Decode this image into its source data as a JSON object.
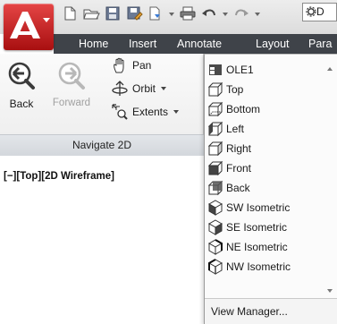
{
  "quick_access": {
    "icons": [
      "new-icon",
      "open-icon",
      "save-icon",
      "save-as-icon",
      "publish-icon",
      "plot-icon",
      "undo-icon",
      "redo-icon",
      "workspace-gear-icon"
    ],
    "workspace_text": "D"
  },
  "tabs": [
    {
      "label": "Home"
    },
    {
      "label": "Insert"
    },
    {
      "label": "Annotate"
    },
    {
      "label": "Layout"
    },
    {
      "label": "Para"
    }
  ],
  "navigate_panel": {
    "title": "Navigate 2D",
    "back_label": "Back",
    "forward_label": "Forward",
    "pan_label": "Pan",
    "orbit_label": "Orbit",
    "extents_label": "Extents"
  },
  "viewport": {
    "label": "[−][Top][2D Wireframe]"
  },
  "views_menu": {
    "items": [
      {
        "label": "OLE1",
        "icon": "named-view-icon"
      },
      {
        "label": "Top",
        "icon": "top-view-icon"
      },
      {
        "label": "Bottom",
        "icon": "bottom-view-icon"
      },
      {
        "label": "Left",
        "icon": "left-view-icon"
      },
      {
        "label": "Right",
        "icon": "right-view-icon"
      },
      {
        "label": "Front",
        "icon": "front-view-icon"
      },
      {
        "label": "Back",
        "icon": "back-view-icon"
      },
      {
        "label": "SW Isometric",
        "icon": "sw-isometric-icon"
      },
      {
        "label": "SE Isometric",
        "icon": "se-isometric-icon"
      },
      {
        "label": "NE Isometric",
        "icon": "ne-isometric-icon"
      },
      {
        "label": "NW Isometric",
        "icon": "nw-isometric-icon"
      }
    ],
    "manager_label": "View Manager..."
  },
  "colors": {
    "app_button": "#c62020",
    "tab_bar": "#3f4349",
    "tab_text": "#ffffff",
    "panel_title_bg": "#d9dde2"
  }
}
